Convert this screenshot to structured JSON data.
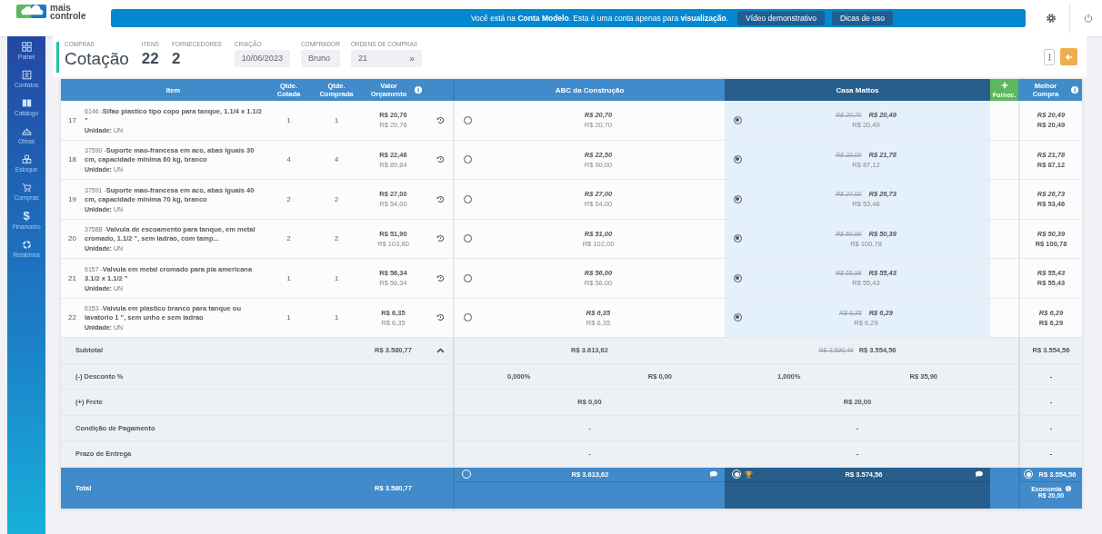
{
  "logo": {
    "line_1": "mais",
    "line_2": "controle"
  },
  "banner": {
    "message": "Você está na **Conta Modelo**. Esta é uma conta apenas para **visualização**.",
    "buttons": [
      "Vídeo demonstrativo",
      "Dicas de uso"
    ]
  },
  "sidebar": {
    "items": [
      {
        "label": "Painel",
        "kind": "grid"
      },
      {
        "label": "Contatos",
        "kind": "contact"
      },
      {
        "label": "Catálogo",
        "kind": "catalog"
      },
      {
        "label": "Obras",
        "kind": "hardhat"
      },
      {
        "label": "Estoque",
        "kind": "boxes"
      },
      {
        "label": "Compras",
        "kind": "cart"
      },
      {
        "label": "Financeiro",
        "kind": "glyph",
        "glyph": "$"
      },
      {
        "label": "Relatórios",
        "kind": "ring"
      }
    ]
  },
  "header": {
    "section": "COMPRAS",
    "title": "Cotação",
    "stats": [
      {
        "label": "ITENS",
        "value": "22"
      },
      {
        "label": "FORNECEDORES",
        "value": "2"
      }
    ],
    "fields": [
      {
        "label": "CRIAÇÃO",
        "value": "10/06/2023"
      },
      {
        "label": "COMPRADOR",
        "value": "Bruno"
      },
      {
        "label": "ORDENS DE COMPRAS",
        "value": "21",
        "action": "»"
      }
    ]
  },
  "table": {
    "columns": [
      "Item",
      "Qtde. Cotada",
      "Qtde. Comprada",
      "Valor Orçamento"
    ],
    "suppliers": [
      {
        "name": "ABC da Construção",
        "selected": false
      },
      {
        "name": "Casa Mattos",
        "selected": true
      }
    ],
    "add_supplier": "Fornec.",
    "best_column": "Melhor Compra",
    "rows": [
      {
        "number": "17",
        "code": "6146 -",
        "description": "Sifao plastico tipo copo para tanque, 1.1/4 x 1.1/2 \"",
        "unit_label": "Unidade:",
        "unit": "UN",
        "qty_quoted": "1",
        "qty_bought": "1",
        "budget_unit": "R$ 20,76",
        "budget_total": "R$ 20,76",
        "quotes": [
          {
            "unit": "R$ 20,70",
            "total": "R$ 20,70",
            "chosen": false
          },
          {
            "original": "R$ 20,70",
            "unit": "R$ 20,49",
            "total": "R$ 20,49",
            "chosen": true
          }
        ],
        "best_unit": "R$ 20,49",
        "best_total": "R$ 20,49"
      },
      {
        "number": "18",
        "code": "37590 -",
        "description": "Suporte mao-francesa em aco, abas iguais 30 cm, capacidade minima 60 kg, branco",
        "unit_label": "Unidade:",
        "unit": "UN",
        "qty_quoted": "4",
        "qty_bought": "4",
        "budget_unit": "R$ 22,46",
        "budget_total": "R$ 89,84",
        "quotes": [
          {
            "unit": "R$ 22,50",
            "total": "R$ 90,00",
            "chosen": false
          },
          {
            "original": "R$ 22,00",
            "unit": "R$ 21,78",
            "total": "R$ 87,12",
            "chosen": true
          }
        ],
        "best_unit": "R$ 21,78",
        "best_total": "R$ 87,12"
      },
      {
        "number": "19",
        "code": "37591 -",
        "description": "Suporte mao-francesa em aco, abas iguais 40 cm, capacidade minima 70 kg, branco",
        "unit_label": "Unidade:",
        "unit": "UN",
        "qty_quoted": "2",
        "qty_bought": "2",
        "budget_unit": "R$ 27,00",
        "budget_total": "R$ 54,00",
        "quotes": [
          {
            "unit": "R$ 27,00",
            "total": "R$ 54,00",
            "chosen": false
          },
          {
            "original": "R$ 27,00",
            "unit": "R$ 26,73",
            "total": "R$ 53,46",
            "chosen": true
          }
        ],
        "best_unit": "R$ 26,73",
        "best_total": "R$ 53,46"
      },
      {
        "number": "20",
        "code": "37588 -",
        "description": "Valvula de escoamento para tanque, em metal cromado, 1.1/2 \", sem ladrao, com tamp...",
        "unit_label": "Unidade:",
        "unit": "UN",
        "qty_quoted": "2",
        "qty_bought": "2",
        "budget_unit": "R$ 51,90",
        "budget_total": "R$ 103,80",
        "quotes": [
          {
            "unit": "R$ 51,00",
            "total": "R$ 102,00",
            "chosen": false
          },
          {
            "original": "R$ 50,90",
            "unit": "R$ 50,39",
            "total": "R$ 100,78",
            "chosen": true
          }
        ],
        "best_unit": "R$ 50,39",
        "best_total": "R$ 100,78"
      },
      {
        "number": "21",
        "code": "6157 -",
        "description": "Valvula em metal cromado para pia americana 3.1/2 x 1.1/2 \"",
        "unit_label": "Unidade:",
        "unit": "UN",
        "qty_quoted": "1",
        "qty_bought": "1",
        "budget_unit": "R$ 56,34",
        "budget_total": "R$ 56,34",
        "quotes": [
          {
            "unit": "R$ 56,00",
            "total": "R$ 56,00",
            "chosen": false
          },
          {
            "original": "R$ 55,99",
            "unit": "R$ 55,43",
            "total": "R$ 55,43",
            "chosen": true
          }
        ],
        "best_unit": "R$ 55,43",
        "best_total": "R$ 55,43"
      },
      {
        "number": "22",
        "code": "6153 -",
        "description": "Valvula em plastico branco para tanque ou lavatorio 1 \", sem unho e sem ladrao",
        "unit_label": "Unidade:",
        "unit": "UN",
        "qty_quoted": "1",
        "qty_bought": "1",
        "budget_unit": "R$ 6,35",
        "budget_total": "R$ 6,35",
        "quotes": [
          {
            "unit": "R$ 6,35",
            "total": "R$ 6,35",
            "chosen": false
          },
          {
            "original": "R$ 6,35",
            "unit": "R$ 6,29",
            "total": "R$ 6,29",
            "chosen": true
          }
        ],
        "best_unit": "R$ 6,29",
        "best_total": "R$ 6,29"
      }
    ],
    "summary": [
      {
        "label": "Subtotal",
        "budget": "R$ 3.580,77",
        "expanded": true,
        "suppliers": [
          {
            "value": "R$ 3.613,62"
          },
          {
            "original": "R$ 3.590,46",
            "value": "R$ 3.554,56"
          }
        ],
        "best": "R$ 3.554,56"
      },
      {
        "label": "(-) Desconto %",
        "suppliers": [
          {
            "percent": "0,000%",
            "value": "R$ 0,00"
          },
          {
            "percent": "1,000%",
            "value": "R$ 35,90"
          }
        ],
        "best": "-"
      },
      {
        "label": "(+) Frete",
        "suppliers": [
          {
            "value": "R$ 0,00"
          },
          {
            "value": "R$ 20,00"
          }
        ],
        "best": "-"
      },
      {
        "label": "Condição de Pagamento",
        "suppliers": [
          {
            "value": "-"
          },
          {
            "value": "-"
          }
        ],
        "best": "-"
      },
      {
        "label": "Prazo de Entrega",
        "suppliers": [
          {
            "value": "-"
          },
          {
            "value": "-"
          }
        ],
        "best": "-"
      }
    ],
    "total": {
      "label": "Total",
      "budget": "R$ 3.580,77",
      "suppliers": [
        {
          "value": "R$ 3.613,62",
          "chosen": false,
          "winner": false
        },
        {
          "value": "R$ 3.574,56",
          "chosen": true,
          "winner": true
        }
      ],
      "best": {
        "value": "R$ 3.554,56",
        "chosen": true,
        "savings_label": "Economia",
        "savings": "R$ 20,00"
      }
    }
  }
}
